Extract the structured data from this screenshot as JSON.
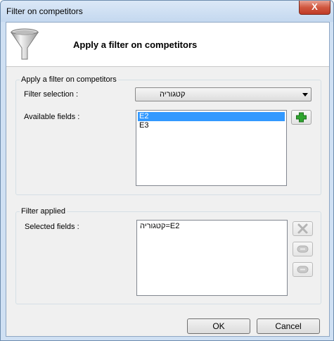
{
  "window": {
    "title": "Filter on competitors",
    "close_glyph": "X"
  },
  "header": {
    "title": "Apply a filter on competitors",
    "icon": "funnel-icon"
  },
  "filter_group": {
    "label": "Apply a filter on competitors",
    "filter_selection_label": "Filter selection :",
    "filter_selection_value": "קטגוריה",
    "available_fields_label": "Available fields :",
    "available_fields": [
      {
        "text": "E2",
        "selected": true
      },
      {
        "text": "E3",
        "selected": false
      }
    ],
    "add_icon": "plus-icon"
  },
  "applied_group": {
    "label": "Filter applied",
    "selected_fields_label": "Selected fields :",
    "selected_fields": [
      {
        "text": "קטגוריה=E2"
      }
    ],
    "side_icons": [
      "remove-icon",
      "and-icon",
      "or-icon"
    ]
  },
  "footer": {
    "ok_label": "OK",
    "cancel_label": "Cancel"
  },
  "colors": {
    "selection": "#3399ff",
    "add_green": "#2fa52f",
    "close_red": "#c9452f"
  }
}
